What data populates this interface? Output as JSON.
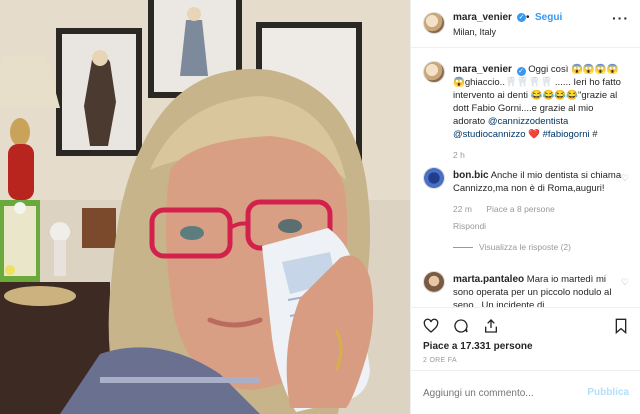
{
  "post": {
    "username": "mara_venier",
    "follow_label": "Segui",
    "separator": "•",
    "location": "Milan, Italy",
    "more_icon": "ellipsis-icon"
  },
  "caption": {
    "username": "mara_venier",
    "text_part1": "Oggi così 😱😱😱😱😱ghiaccio..🦷🦷🦷🦷 ...... Ieri ho fatto intervento ai denti 😂😂😂😂\"grazie al dott Fabio Gorni....e grazie al mio adorato ",
    "mention1": "@cannizzodentista",
    "mention2": "@studiocannizzo",
    "heart": "❤️",
    "hashtag": "#fabiogorni",
    "tail": " #",
    "time": "2 h"
  },
  "comments": [
    {
      "username": "bon.bic",
      "text": "Anche il mio dentista si chiama Cannizzo,ma non è di Roma,auguri!",
      "time": "22 m",
      "likes": "Piace a 8 persone",
      "reply": "Rispondi",
      "view_replies": "Visualizza le risposte (2)"
    },
    {
      "username": "marta.pantaleo",
      "text": "Mara io martedì mi sono operata per un piccolo nodulo al seno . Un incidente di"
    }
  ],
  "actions": {
    "likes_text": "Piace a 17.331 persone",
    "time_ago": "2 ORE FA"
  },
  "comment_box": {
    "placeholder": "Aggiungi un commento...",
    "publish_label": "Pubblica"
  }
}
